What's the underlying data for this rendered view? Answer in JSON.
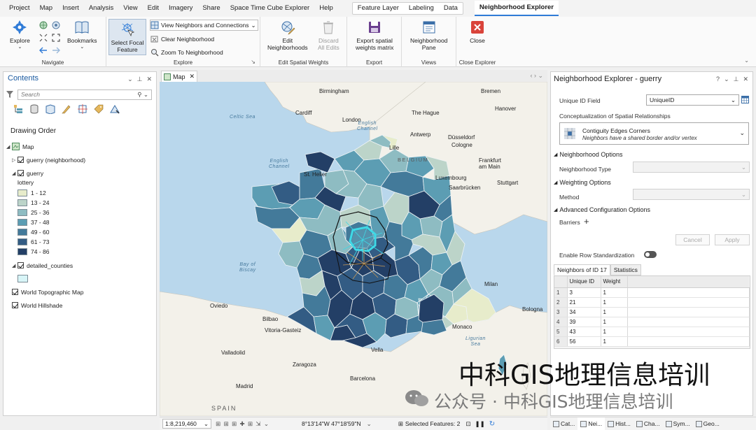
{
  "menu": {
    "items": [
      "Project",
      "Map",
      "Insert",
      "Analysis",
      "View",
      "Edit",
      "Imagery",
      "Share",
      "Space Time Cube Explorer",
      "Help"
    ],
    "context_tabs": [
      "Feature Layer",
      "Labeling",
      "Data"
    ],
    "active_tab": "Neighborhood Explorer"
  },
  "ribbon": {
    "navigate": {
      "label": "Navigate",
      "explore": "Explore",
      "bookmarks": "Bookmarks"
    },
    "explore": {
      "label": "Explore",
      "select_focal_1": "Select Focal",
      "select_focal_2": "Feature",
      "view_neighbors": "View Neighbors and Connections",
      "clear_neighborhood": "Clear Neighborhood",
      "zoom_to_neighborhood": "Zoom To Neighborhood"
    },
    "edit_weights": {
      "label": "Edit Spatial Weights",
      "edit_1": "Edit",
      "edit_2": "Neighborhoods",
      "discard_1": "Discard",
      "discard_2": "All Edits"
    },
    "export": {
      "label": "Export",
      "btn_1": "Export spatial",
      "btn_2": "weights matrix"
    },
    "views": {
      "label": "Views",
      "btn_1": "Neighborhood",
      "btn_2": "Pane"
    },
    "close": {
      "label": "Close Explorer",
      "btn": "Close"
    },
    "colors": {
      "close_red": "#d9433a",
      "save_purple": "#6b3f8f"
    }
  },
  "contents": {
    "title": "Contents",
    "search_placeholder": "Search",
    "drawing_order": "Drawing Order",
    "layers": {
      "map": "Map",
      "guerry_neighborhood": "guerry (neighborhood)",
      "guerry": "guerry",
      "lottery": "lottery",
      "detailed_counties": "detailed_counties",
      "topo": "World Topographic Map",
      "hillshade": "World Hillshade"
    },
    "legend": [
      {
        "label": "1 - 12",
        "color": "#e7eccb"
      },
      {
        "label": "13 - 24",
        "color": "#bcd4c9"
      },
      {
        "label": "25 - 36",
        "color": "#8ebcc2"
      },
      {
        "label": "37 - 48",
        "color": "#5c9db3"
      },
      {
        "label": "49 - 60",
        "color": "#437a9a"
      },
      {
        "label": "61 - 73",
        "color": "#335c84"
      },
      {
        "label": "74 - 86",
        "color": "#233f66"
      }
    ],
    "counties_swatch": "#d8f5f7"
  },
  "map": {
    "tab": "Map",
    "places": {
      "birmingham": "Birmingham",
      "cardiff": "Cardiff",
      "london": "London",
      "thehague": "The Hague",
      "bremen": "Bremen",
      "hanover": "Hanover",
      "antwerp": "Antwerp",
      "dusseldorf": "Düsseldorf",
      "cologne": "Cologne",
      "lille": "Lille",
      "frankfurt_1": "Frankfurt",
      "frankfurt_2": "am Main",
      "luxembourg": "Luxembourg",
      "saarbrucken": "Saarbrücken",
      "stuttgart": "Stuttgart",
      "stmalo": "St. Helier",
      "milan": "Milan",
      "oviedo": "Oviedo",
      "bilbao": "Bilbao",
      "vitoria": "Vitoria-Gasteiz",
      "bologna": "Bologna",
      "monaco": "Monaco",
      "valladolid": "Valladolid",
      "zaragoza": "Zaragoza",
      "barcelona": "Barcelona",
      "madrid": "Madrid",
      "vella": "Vella"
    },
    "seas": {
      "celtic": "Celtic Sea",
      "english_1": "English",
      "english_2": "Channel",
      "channel_1": "English",
      "channel_2": "Channel",
      "biscay_1": "Bay of",
      "biscay_2": "Biscay",
      "ligurian_1": "Ligurian",
      "ligurian_2": "Sea"
    },
    "countries": {
      "belgium": "BELGIUM",
      "spain": "SPAIN"
    },
    "neighborhood_color": "#3fd9e6",
    "focal_outline": "#111111"
  },
  "status": {
    "scale": "1:8,219,460",
    "coords": "8°13'14\"W 47°18'59\"N",
    "selected": "Selected Features: 2"
  },
  "explorer": {
    "title": "Neighborhood Explorer - guerry",
    "unique_id_label": "Unique ID Field",
    "unique_id_value": "UniqueID",
    "concept_label": "Conceptualization of Spatial Relationships",
    "concept_title": "Contiguity Edges Corners",
    "concept_desc": "Neighbors have a shared border and/or vertex",
    "neighborhood_options": "Neighborhood Options",
    "neighborhood_type": "Neighborhood Type",
    "weighting_options": "Weighting Options",
    "method": "Method",
    "advanced": "Advanced Configuration Options",
    "barriers": "Barriers",
    "cancel": "Cancel",
    "apply": "Apply",
    "row_std": "Enable Row Standardization",
    "tab_neighbors": "Neighbors of ID 17",
    "tab_stats": "Statistics",
    "col_id": "Unique ID",
    "col_weight": "Weight",
    "rows": [
      {
        "n": "1",
        "id": "3",
        "w": "1"
      },
      {
        "n": "2",
        "id": "21",
        "w": "1"
      },
      {
        "n": "3",
        "id": "34",
        "w": "1"
      },
      {
        "n": "4",
        "id": "39",
        "w": "1"
      },
      {
        "n": "5",
        "id": "43",
        "w": "1"
      },
      {
        "n": "6",
        "id": "56",
        "w": "1"
      }
    ]
  },
  "dock": {
    "catalog": "Cat...",
    "neighborhood": "Nei...",
    "history": "Hist...",
    "charts": "Cha...",
    "symbology": "Sym...",
    "geo": "Geo..."
  },
  "watermark": {
    "line1": "中科GIS地理信息培训",
    "line2": "公众号 · 中科GIS地理信息培训"
  }
}
